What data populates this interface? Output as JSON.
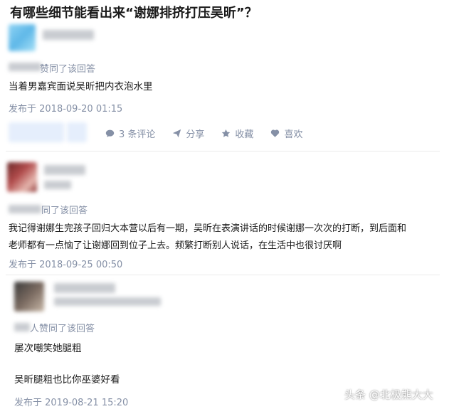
{
  "question_title": "有哪些细节能看出来“谢娜排挤打压吴昕”？",
  "answers": [
    {
      "agree_text": "赞同了该回答",
      "content": "当着男嘉宾面说吴昕把内衣泡水里",
      "date": "发布于 2018-09-20 01:15",
      "actions": {
        "comments": "3 条评论",
        "share": "分享",
        "favorite": "收藏",
        "like": "喜欢"
      }
    },
    {
      "agree_text": "同了该回答",
      "content_line1": "我记得谢娜生完孩子回归大本营以后有一期，吴昕在表演讲话的时候谢娜一次次的打断，到后面和",
      "content_line2": "老师都有一点恼了让谢娜回到位子上去。频繁打断别人说话，在生活中也很讨厌啊",
      "date": "发布于 2018-09-25 00:50"
    },
    {
      "agree_text": "人赞同了该回答",
      "content_line1": "屡次嘲笑她腿粗",
      "content_line2": "吴昕腿粗也比你巫婆好看",
      "date": "发布于 2019-08-21 15:20"
    }
  ],
  "watermark": "头条 @北极熊大大",
  "colors": {
    "meta_gray": "#8590a6",
    "vote_bg": "#e5eefc",
    "divider": "#ebebeb"
  }
}
